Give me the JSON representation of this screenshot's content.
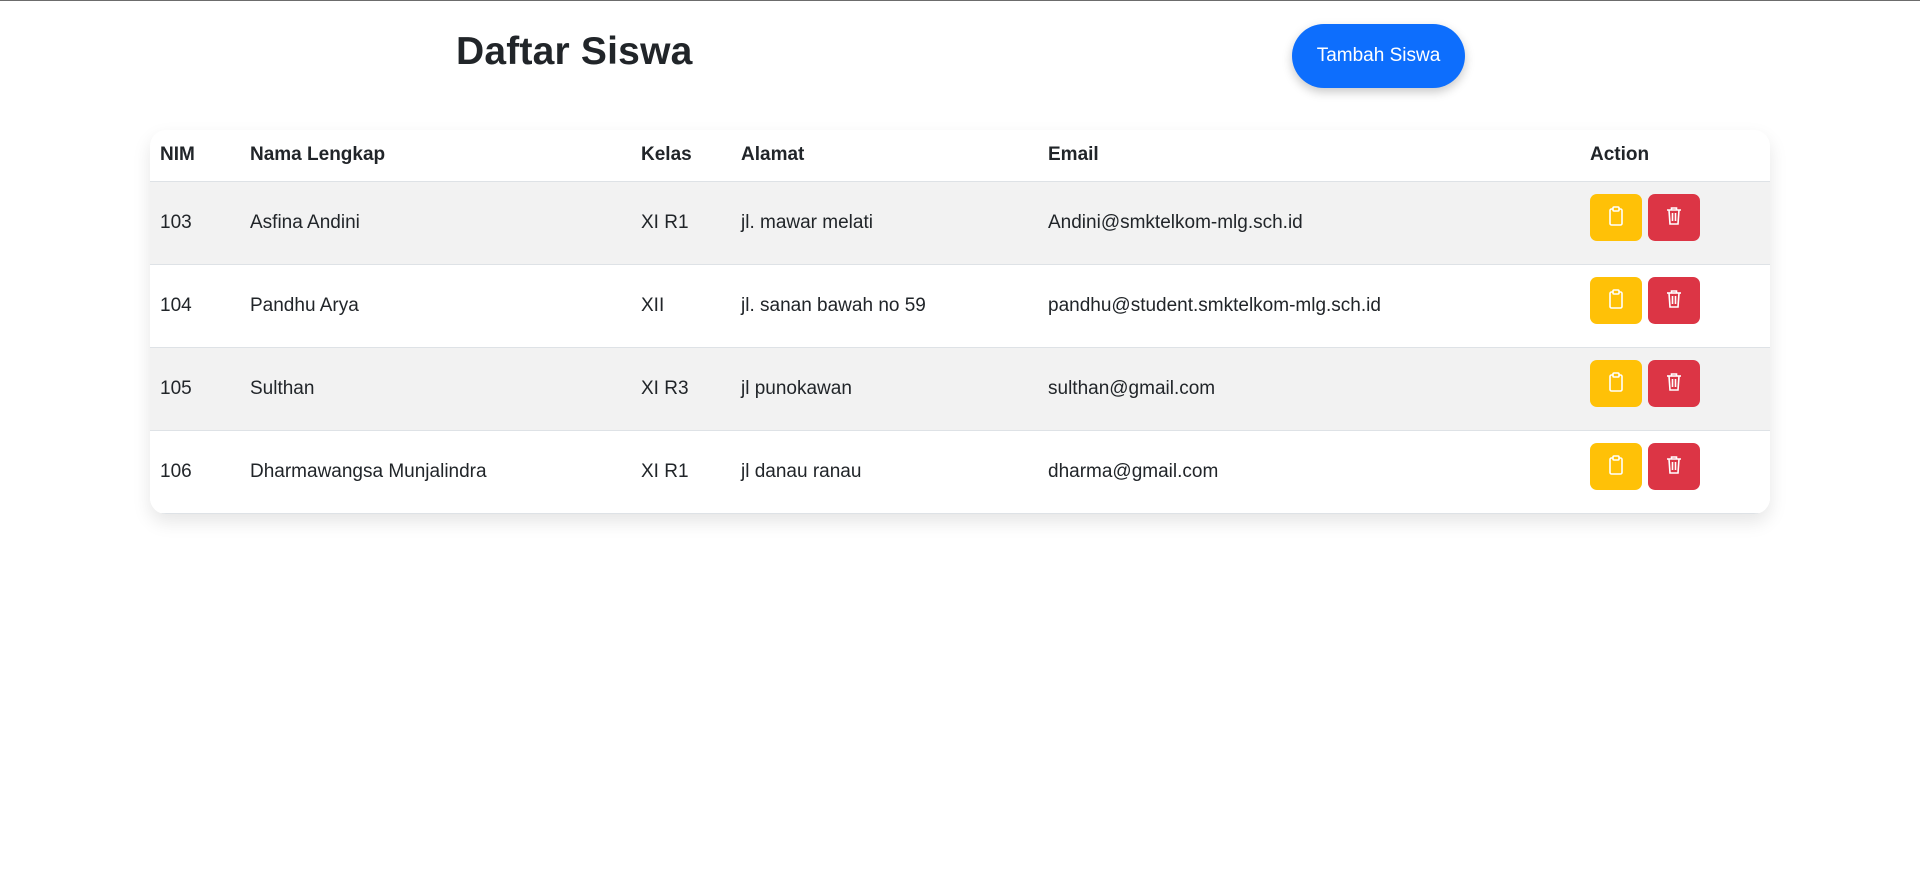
{
  "header": {
    "title": "Daftar Siswa",
    "add_button_label": "Tambah Siswa"
  },
  "table": {
    "columns": [
      "NIM",
      "Nama Lengkap",
      "Kelas",
      "Alamat",
      "Email",
      "Action"
    ],
    "rows": [
      {
        "nim": "103",
        "nama": "Asfina Andini",
        "kelas": "XI R1",
        "alamat": "jl. mawar melati",
        "email": "Andini@smktelkom-mlg.sch.id"
      },
      {
        "nim": "104",
        "nama": "Pandhu Arya",
        "kelas": "XII",
        "alamat": "jl. sanan bawah no 59",
        "email": "pandhu@student.smktelkom-mlg.sch.id"
      },
      {
        "nim": "105",
        "nama": "Sulthan",
        "kelas": "XI R3",
        "alamat": "jl punokawan",
        "email": "sulthan@gmail.com"
      },
      {
        "nim": "106",
        "nama": "Dharmawangsa Munjalindra",
        "kelas": "XI R1",
        "alamat": "jl danau ranau",
        "email": "dharma@gmail.com"
      }
    ]
  },
  "icons": {
    "edit": "clipboard-icon",
    "delete": "trash-icon"
  },
  "colors": {
    "primary": "#0d6efd",
    "edit": "#ffc107",
    "delete": "#dc3545",
    "row_stripe": "#f2f2f2"
  }
}
